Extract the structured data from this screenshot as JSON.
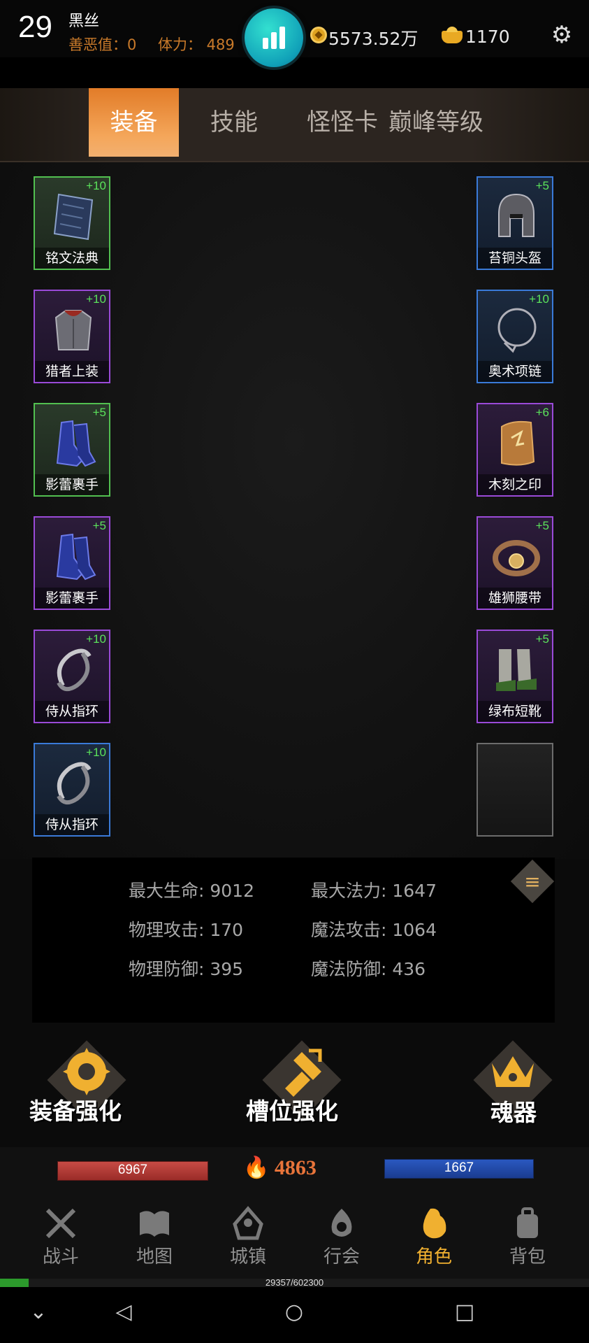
{
  "player": {
    "level": "29",
    "name": "黑丝",
    "karma_label": "善恶值：0",
    "stamina_label": "体力： 489",
    "coins": "5573.52万",
    "ingots": "1170"
  },
  "tabs": [
    {
      "label": "装备",
      "active": true
    },
    {
      "label": "技能",
      "active": false
    },
    {
      "label": "怪怪卡",
      "active": false
    },
    {
      "label": "巅峰等级",
      "active": false
    }
  ],
  "equipment": {
    "left": [
      {
        "name": "铭文法典",
        "plus": "+10",
        "rarity": "green"
      },
      {
        "name": "猎者上装",
        "plus": "+10",
        "rarity": "purple"
      },
      {
        "name": "影蕾裹手",
        "plus": "+5",
        "rarity": "green"
      },
      {
        "name": "影蕾裹手",
        "plus": "+5",
        "rarity": "purple"
      },
      {
        "name": "侍从指环",
        "plus": "+10",
        "rarity": "purple"
      },
      {
        "name": "侍从指环",
        "plus": "+10",
        "rarity": "blue"
      }
    ],
    "right": [
      {
        "name": "苔铜头盔",
        "plus": "+5",
        "rarity": "blue"
      },
      {
        "name": "奥术项链",
        "plus": "+10",
        "rarity": "blue"
      },
      {
        "name": "木刻之印",
        "plus": "+6",
        "rarity": "purple"
      },
      {
        "name": "雄狮腰带",
        "plus": "+5",
        "rarity": "purple"
      },
      {
        "name": "绿布短靴",
        "plus": "+5",
        "rarity": "purple"
      },
      {
        "name": "",
        "plus": "",
        "rarity": "empty"
      }
    ]
  },
  "stats": {
    "max_hp": "最大生命: 9012",
    "max_mp": "最大法力: 1647",
    "phys_atk": "物理攻击: 170",
    "mag_atk": "魔法攻击: 1064",
    "phys_def": "物理防御: 395",
    "mag_def": "魔法防御: 436"
  },
  "actions": {
    "enhance": "装备强化",
    "slot_enhance": "槽位强化",
    "soul": "魂器"
  },
  "hud": {
    "hp": "6967",
    "mp": "1667",
    "power": "4863",
    "xp_text": "29357/602300",
    "xp_fraction": 0.0487
  },
  "nav": [
    {
      "label": "战斗",
      "icon": "swords-icon",
      "active": false
    },
    {
      "label": "地图",
      "icon": "map-book-icon",
      "active": false
    },
    {
      "label": "城镇",
      "icon": "town-icon",
      "active": false
    },
    {
      "label": "行会",
      "icon": "guild-icon",
      "active": false
    },
    {
      "label": "角色",
      "icon": "character-icon",
      "active": true
    },
    {
      "label": "背包",
      "icon": "backpack-icon",
      "active": false
    }
  ],
  "colors": {
    "accent_orange": "#f4a65a",
    "rarity_green": "#52c050",
    "rarity_purple": "#9a4ad8",
    "rarity_blue": "#3a7ad8"
  }
}
